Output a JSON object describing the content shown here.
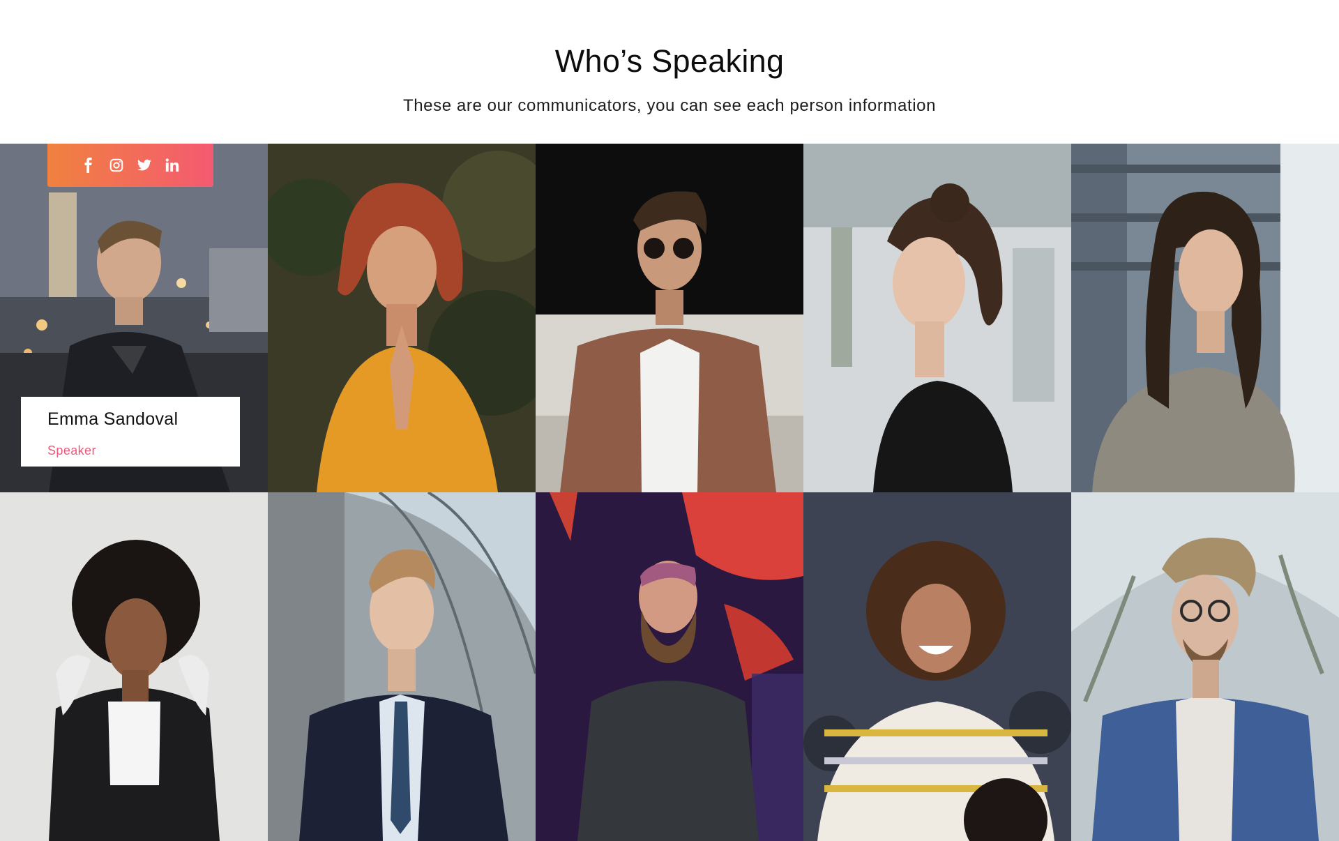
{
  "section": {
    "title": "Who’s Speaking",
    "subtitle": "These are our communicators, you can see each person information"
  },
  "colors": {
    "accent_start": "#f0813f",
    "accent_end": "#f45a71",
    "role_text": "#e95a7a"
  },
  "featured": {
    "name": "Emma Sandoval",
    "role": "Speaker",
    "social_icons": [
      "facebook-icon",
      "instagram-icon",
      "twitter-icon",
      "linkedin-icon"
    ]
  }
}
